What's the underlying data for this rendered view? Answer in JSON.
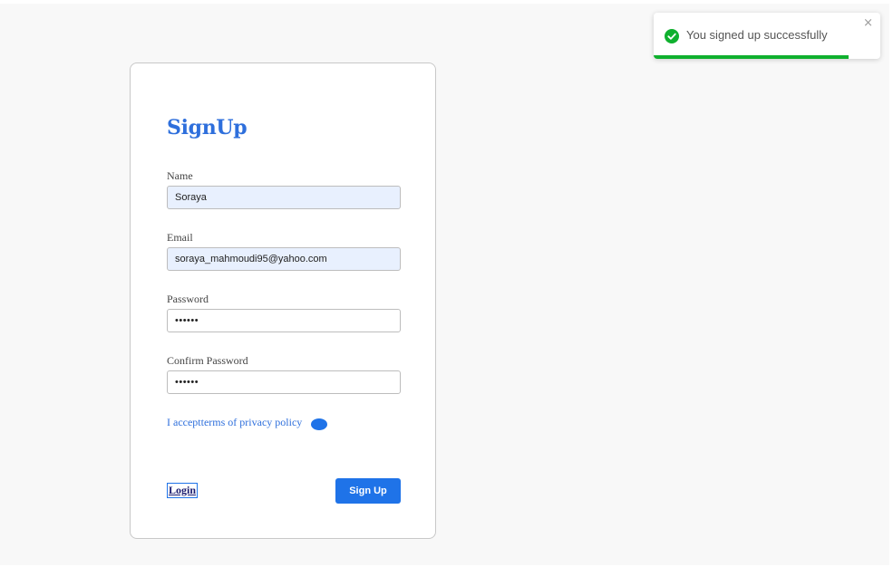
{
  "form": {
    "title": "SignUp",
    "name": {
      "label": "Name",
      "value": "Soraya"
    },
    "email": {
      "label": "Email",
      "value": "soraya_mahmoudi95@yahoo.com"
    },
    "password": {
      "label": "Password",
      "value": "••••••"
    },
    "confirm_password": {
      "label": "Confirm Password",
      "value": "••••••"
    },
    "terms_text": "I acceptterms of privacy policy",
    "login_label": "Login",
    "signup_label": "Sign Up"
  },
  "toast": {
    "message": "You signed up successfully",
    "status_icon": "check-circle-icon",
    "close_glyph": "×",
    "progress": 0.86
  },
  "colors": {
    "accent": "#1f73e8",
    "title": "#2e6fdc",
    "success": "#0fb02e",
    "autofill_bg": "#e8f0fe",
    "page_bg": "#f8f8f8"
  }
}
